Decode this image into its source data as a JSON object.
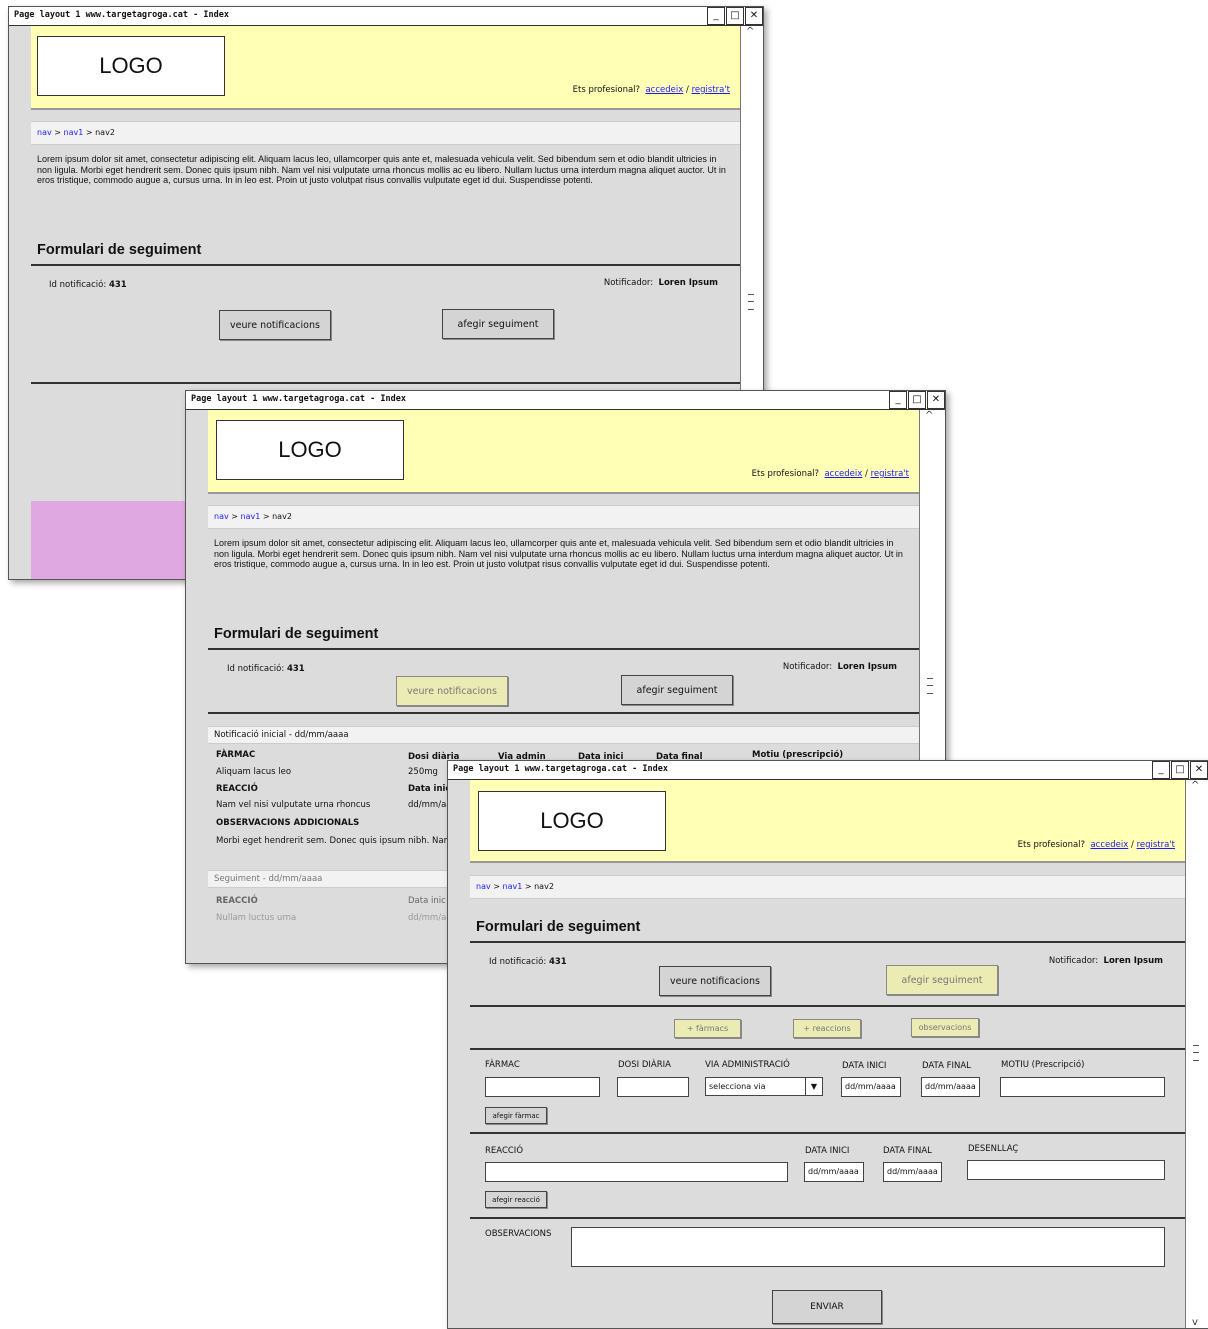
{
  "window_title": "Page layout 1 www.targetagroga.cat - Index",
  "window_buttons": {
    "minimize": "_",
    "maximize": "□",
    "close": "✕"
  },
  "logo": "LOGO",
  "prof": {
    "question": "Ets profesional?",
    "login": "accedeix",
    "sep": "/",
    "register": "registra't"
  },
  "nav": {
    "n1": "nav",
    "sep": ">",
    "n2": "nav1",
    "n3": "nav2"
  },
  "lorem": "Lorem ipsum dolor sit amet, consectetur adipiscing elit. Aliquam lacus leo, ullamcorper quis ante et, malesuada vehicula velit. Sed bibendum sem et odio blandit ultricies in non ligula. Morbi eget hendrerit sem. Donec quis ipsum nibh. Nam vel nisi vulputate urna rhoncus mollis ac eu libero. Nullam luctus urna interdum magna aliquet auctor. Ut in eros tristique, commodo augue a, cursus urna. In in leo est. Proin ut justo volutpat risus convallis vulputate eget id dui. Suspendisse potenti.",
  "form_title": "Formulari de seguiment",
  "id_label": "Id notificació:",
  "id_value": "431",
  "notifier_label": "Notificador:",
  "notifier_value": "Loren Ipsum",
  "btn_view": "veure notificacions",
  "btn_add": "afegir seguiment",
  "initial": {
    "section": "Notificació inicial  -  dd/mm/aaaa",
    "col_farmac": "FÀRMAC",
    "col_dosi": "Dosi diària",
    "col_via": "Via admin",
    "col_inici": "Data inici",
    "col_final": "Data final",
    "col_motiu": "Motiu (prescripció)",
    "farmac_value": "Aliquam lacus leo",
    "dosi_value": "250mg",
    "reaccio_label": "REACCIÓ",
    "reaccio_date_label": "Data inic",
    "reaccio_value": "Nam vel nisi vulputate urna rhoncus",
    "reaccio_date_value": "dd/mm/aa",
    "obs_label": "OBSERVACIONS ADDICIONALS",
    "obs_value": "Morbi eget hendrerit sem. Donec quis ipsum nibh. Nam v"
  },
  "followup": {
    "section": "Seguiment  -  dd/mm/aaaa",
    "reaccio_label": "REACCIÓ",
    "date_label": "Data inic",
    "reaccio_value": "Nullam luctus urna",
    "date_value": "dd/mm/aa"
  },
  "add_buttons": {
    "farmacs": "+ fàrmacs",
    "reaccions": "+ reaccions",
    "observacions": "observacions"
  },
  "drug_form": {
    "farmac": "FÀRMAC",
    "dosi": "DOSI DIÀRIA",
    "via": "VIA ADMINISTRACIÓ",
    "inici": "DATA INICI",
    "final": "DATA FINAL",
    "motiu": "MOTIU (Prescripció)",
    "via_select": "selecciona via",
    "date_placeholder": "dd/mm/aaaa",
    "add_btn": "afegir fàrmac"
  },
  "reaction_form": {
    "reaccio": "REACCIÓ",
    "inici": "DATA INICI",
    "final": "DATA FINAL",
    "desenllac": "DESENLLAÇ",
    "date_placeholder": "dd/mm/aaaa",
    "add_btn": "afegir reacció"
  },
  "observacions_label": "OBSERVACIONS",
  "send_btn": "ENVIAR"
}
